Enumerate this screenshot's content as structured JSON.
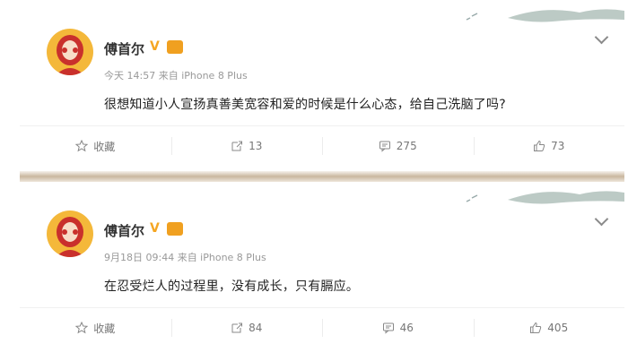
{
  "posts": [
    {
      "author": "傅首尔",
      "vip_v": "V",
      "meta": "今天 14:57 来自 iPhone 8 Plus",
      "text": "很想知道小人宣扬真善美宽容和爱的时候是什么心态，给自己洗脑了吗?",
      "actions": {
        "favorite": "收藏",
        "repost": "13",
        "comment": "275",
        "like": "73"
      }
    },
    {
      "author": "傅首尔",
      "vip_v": "V",
      "meta": "9月18日 09:44 来自 iPhone 8 Plus",
      "text": "在忍受烂人的过程里，没有成长，只有膈应。",
      "actions": {
        "favorite": "收藏",
        "repost": "84",
        "comment": "46",
        "like": "405"
      }
    }
  ],
  "icons": {
    "favorite": "star-icon",
    "repost": "repost-icon",
    "comment": "comment-icon",
    "like": "thumbs-up-icon",
    "menu": "chevron-down-icon",
    "vip": "vip-badge-icon"
  },
  "colors": {
    "vip": "#f5a623",
    "avatar_bg": "#f4b83a",
    "meta": "#999999"
  }
}
